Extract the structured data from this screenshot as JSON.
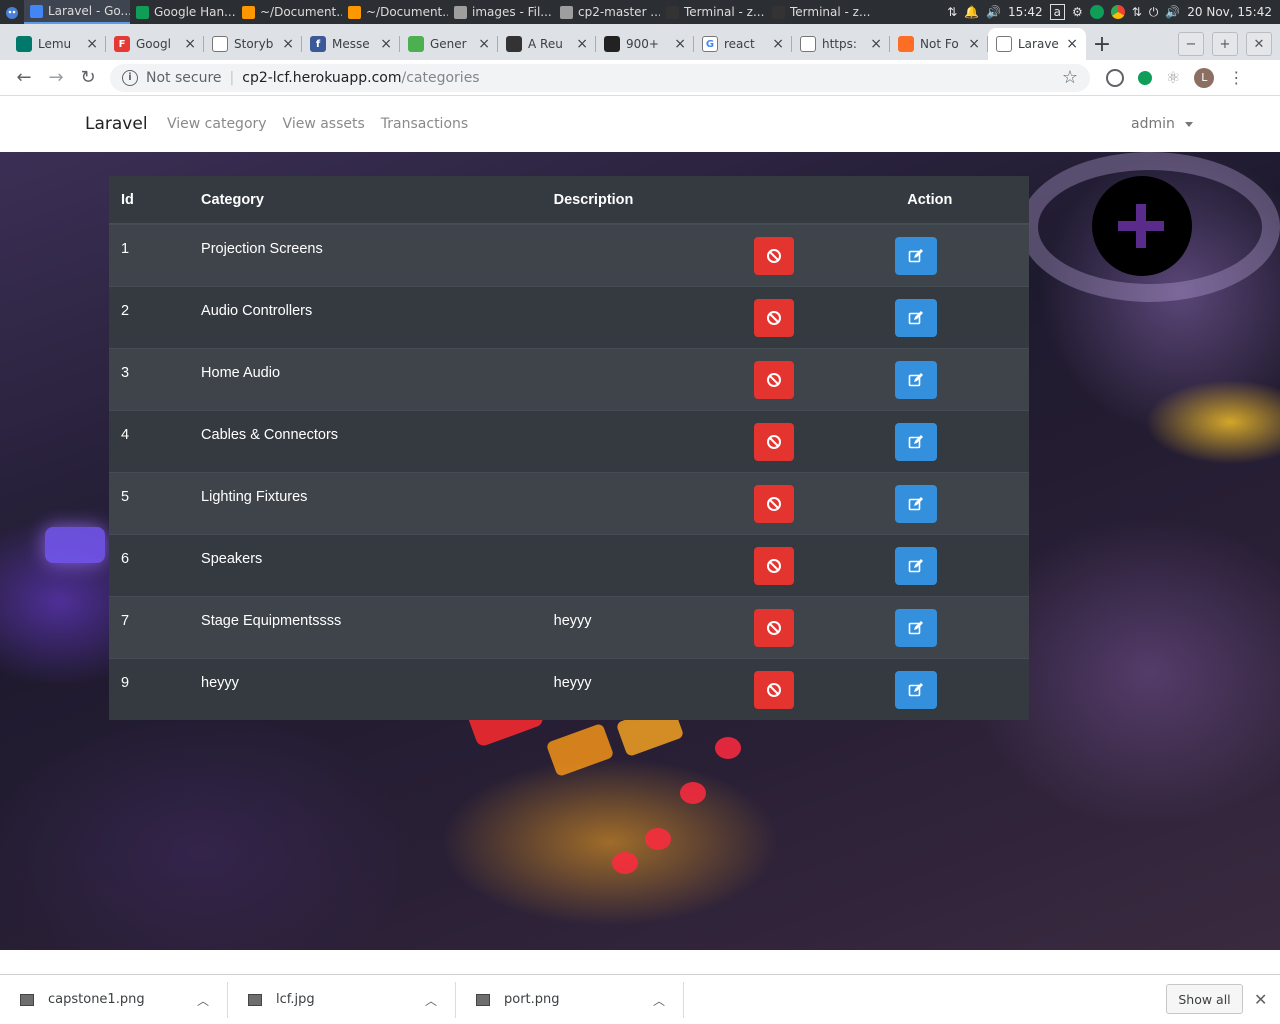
{
  "taskbar": {
    "tasks": [
      {
        "label": "Laravel - Go...",
        "color": "#4285f4"
      },
      {
        "label": "Google Han...",
        "color": "#0f9d58"
      },
      {
        "label": "~/Document...",
        "color": "#ff9800"
      },
      {
        "label": "~/Document...",
        "color": "#ff9800"
      },
      {
        "label": "images - Fil...",
        "color": "#9e9e9e"
      },
      {
        "label": "cp2-master ...",
        "color": "#9e9e9e"
      },
      {
        "label": "Terminal - z...",
        "color": "#333333"
      },
      {
        "label": "Terminal - z...",
        "color": "#333333"
      }
    ],
    "tray_text_a": "a",
    "clock": "15:42",
    "date_time": "20 Nov, 15:42"
  },
  "tabs": [
    {
      "label": "Lemu",
      "fav_color": "#00796b",
      "fav_text": ""
    },
    {
      "label": "Googl",
      "fav_color": "#e53935",
      "fav_text": "F"
    },
    {
      "label": "Storyb",
      "fav_color": "#ffffff",
      "fav_text": ""
    },
    {
      "label": "Messe",
      "fav_color": "#3b5998",
      "fav_text": "f"
    },
    {
      "label": "Gener",
      "fav_color": "#4caf50",
      "fav_text": ""
    },
    {
      "label": "A Reu",
      "fav_color": "#333333",
      "fav_text": ""
    },
    {
      "label": "900+",
      "fav_color": "#222222",
      "fav_text": ""
    },
    {
      "label": "react",
      "fav_color": "#ffffff",
      "fav_text": "G"
    },
    {
      "label": "https:",
      "fav_color": "#ffffff",
      "fav_text": ""
    },
    {
      "label": "Not Fo",
      "fav_color": "#fc6d26",
      "fav_text": ""
    },
    {
      "label": "Larave",
      "fav_color": "#ffffff",
      "fav_text": ""
    }
  ],
  "window": {
    "minimize": "−",
    "maximize": "+",
    "close": "✕"
  },
  "address": {
    "not_secure": "Not secure",
    "host": "cp2-lcf.herokuapp.com",
    "path": "/categories",
    "profile_initial": "L"
  },
  "app": {
    "brand": "Laravel",
    "nav": [
      "View category",
      "View assets",
      "Transactions"
    ],
    "user": "admin"
  },
  "table": {
    "headers": {
      "id": "Id",
      "category": "Category",
      "description": "Description",
      "action": "Action"
    },
    "rows": [
      {
        "id": "1",
        "category": "Projection Screens",
        "description": ""
      },
      {
        "id": "2",
        "category": "Audio Controllers",
        "description": ""
      },
      {
        "id": "3",
        "category": "Home Audio",
        "description": ""
      },
      {
        "id": "4",
        "category": "Cables & Connectors",
        "description": ""
      },
      {
        "id": "5",
        "category": "Lighting Fixtures",
        "description": ""
      },
      {
        "id": "6",
        "category": "Speakers",
        "description": ""
      },
      {
        "id": "7",
        "category": "Stage Equipmentssss",
        "description": "heyyy"
      },
      {
        "id": "9",
        "category": "heyyy",
        "description": "heyyy"
      }
    ]
  },
  "colors": {
    "delete": "#e3342f",
    "edit": "#3490dc",
    "table_bg": "#343a40"
  },
  "downloads": {
    "items": [
      "capstone1.png",
      "lcf.jpg",
      "port.png"
    ],
    "show_all": "Show all"
  }
}
